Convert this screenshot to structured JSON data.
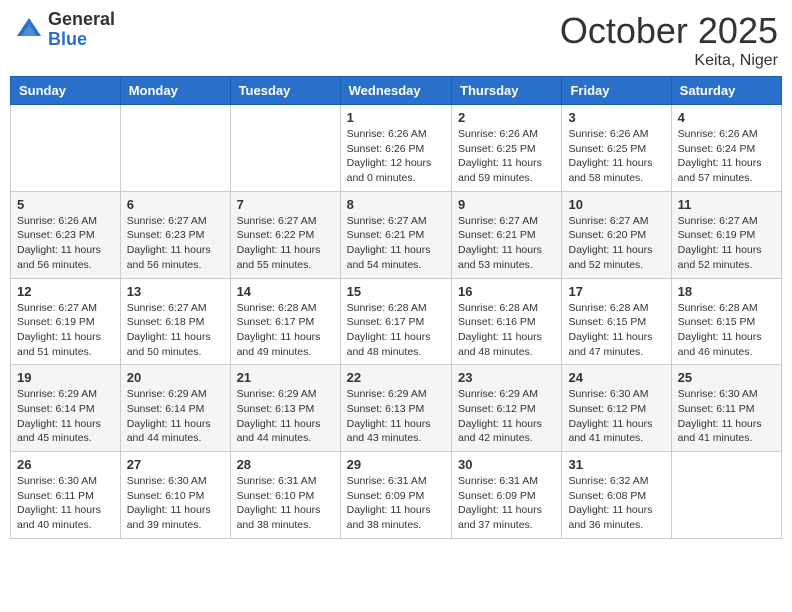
{
  "header": {
    "logo_general": "General",
    "logo_blue": "Blue",
    "month": "October 2025",
    "location": "Keita, Niger"
  },
  "weekdays": [
    "Sunday",
    "Monday",
    "Tuesday",
    "Wednesday",
    "Thursday",
    "Friday",
    "Saturday"
  ],
  "weeks": [
    [
      {
        "day": "",
        "sunrise": "",
        "sunset": "",
        "daylight": ""
      },
      {
        "day": "",
        "sunrise": "",
        "sunset": "",
        "daylight": ""
      },
      {
        "day": "",
        "sunrise": "",
        "sunset": "",
        "daylight": ""
      },
      {
        "day": "1",
        "sunrise": "Sunrise: 6:26 AM",
        "sunset": "Sunset: 6:26 PM",
        "daylight": "Daylight: 12 hours and 0 minutes."
      },
      {
        "day": "2",
        "sunrise": "Sunrise: 6:26 AM",
        "sunset": "Sunset: 6:25 PM",
        "daylight": "Daylight: 11 hours and 59 minutes."
      },
      {
        "day": "3",
        "sunrise": "Sunrise: 6:26 AM",
        "sunset": "Sunset: 6:25 PM",
        "daylight": "Daylight: 11 hours and 58 minutes."
      },
      {
        "day": "4",
        "sunrise": "Sunrise: 6:26 AM",
        "sunset": "Sunset: 6:24 PM",
        "daylight": "Daylight: 11 hours and 57 minutes."
      }
    ],
    [
      {
        "day": "5",
        "sunrise": "Sunrise: 6:26 AM",
        "sunset": "Sunset: 6:23 PM",
        "daylight": "Daylight: 11 hours and 56 minutes."
      },
      {
        "day": "6",
        "sunrise": "Sunrise: 6:27 AM",
        "sunset": "Sunset: 6:23 PM",
        "daylight": "Daylight: 11 hours and 56 minutes."
      },
      {
        "day": "7",
        "sunrise": "Sunrise: 6:27 AM",
        "sunset": "Sunset: 6:22 PM",
        "daylight": "Daylight: 11 hours and 55 minutes."
      },
      {
        "day": "8",
        "sunrise": "Sunrise: 6:27 AM",
        "sunset": "Sunset: 6:21 PM",
        "daylight": "Daylight: 11 hours and 54 minutes."
      },
      {
        "day": "9",
        "sunrise": "Sunrise: 6:27 AM",
        "sunset": "Sunset: 6:21 PM",
        "daylight": "Daylight: 11 hours and 53 minutes."
      },
      {
        "day": "10",
        "sunrise": "Sunrise: 6:27 AM",
        "sunset": "Sunset: 6:20 PM",
        "daylight": "Daylight: 11 hours and 52 minutes."
      },
      {
        "day": "11",
        "sunrise": "Sunrise: 6:27 AM",
        "sunset": "Sunset: 6:19 PM",
        "daylight": "Daylight: 11 hours and 52 minutes."
      }
    ],
    [
      {
        "day": "12",
        "sunrise": "Sunrise: 6:27 AM",
        "sunset": "Sunset: 6:19 PM",
        "daylight": "Daylight: 11 hours and 51 minutes."
      },
      {
        "day": "13",
        "sunrise": "Sunrise: 6:27 AM",
        "sunset": "Sunset: 6:18 PM",
        "daylight": "Daylight: 11 hours and 50 minutes."
      },
      {
        "day": "14",
        "sunrise": "Sunrise: 6:28 AM",
        "sunset": "Sunset: 6:17 PM",
        "daylight": "Daylight: 11 hours and 49 minutes."
      },
      {
        "day": "15",
        "sunrise": "Sunrise: 6:28 AM",
        "sunset": "Sunset: 6:17 PM",
        "daylight": "Daylight: 11 hours and 48 minutes."
      },
      {
        "day": "16",
        "sunrise": "Sunrise: 6:28 AM",
        "sunset": "Sunset: 6:16 PM",
        "daylight": "Daylight: 11 hours and 48 minutes."
      },
      {
        "day": "17",
        "sunrise": "Sunrise: 6:28 AM",
        "sunset": "Sunset: 6:15 PM",
        "daylight": "Daylight: 11 hours and 47 minutes."
      },
      {
        "day": "18",
        "sunrise": "Sunrise: 6:28 AM",
        "sunset": "Sunset: 6:15 PM",
        "daylight": "Daylight: 11 hours and 46 minutes."
      }
    ],
    [
      {
        "day": "19",
        "sunrise": "Sunrise: 6:29 AM",
        "sunset": "Sunset: 6:14 PM",
        "daylight": "Daylight: 11 hours and 45 minutes."
      },
      {
        "day": "20",
        "sunrise": "Sunrise: 6:29 AM",
        "sunset": "Sunset: 6:14 PM",
        "daylight": "Daylight: 11 hours and 44 minutes."
      },
      {
        "day": "21",
        "sunrise": "Sunrise: 6:29 AM",
        "sunset": "Sunset: 6:13 PM",
        "daylight": "Daylight: 11 hours and 44 minutes."
      },
      {
        "day": "22",
        "sunrise": "Sunrise: 6:29 AM",
        "sunset": "Sunset: 6:13 PM",
        "daylight": "Daylight: 11 hours and 43 minutes."
      },
      {
        "day": "23",
        "sunrise": "Sunrise: 6:29 AM",
        "sunset": "Sunset: 6:12 PM",
        "daylight": "Daylight: 11 hours and 42 minutes."
      },
      {
        "day": "24",
        "sunrise": "Sunrise: 6:30 AM",
        "sunset": "Sunset: 6:12 PM",
        "daylight": "Daylight: 11 hours and 41 minutes."
      },
      {
        "day": "25",
        "sunrise": "Sunrise: 6:30 AM",
        "sunset": "Sunset: 6:11 PM",
        "daylight": "Daylight: 11 hours and 41 minutes."
      }
    ],
    [
      {
        "day": "26",
        "sunrise": "Sunrise: 6:30 AM",
        "sunset": "Sunset: 6:11 PM",
        "daylight": "Daylight: 11 hours and 40 minutes."
      },
      {
        "day": "27",
        "sunrise": "Sunrise: 6:30 AM",
        "sunset": "Sunset: 6:10 PM",
        "daylight": "Daylight: 11 hours and 39 minutes."
      },
      {
        "day": "28",
        "sunrise": "Sunrise: 6:31 AM",
        "sunset": "Sunset: 6:10 PM",
        "daylight": "Daylight: 11 hours and 38 minutes."
      },
      {
        "day": "29",
        "sunrise": "Sunrise: 6:31 AM",
        "sunset": "Sunset: 6:09 PM",
        "daylight": "Daylight: 11 hours and 38 minutes."
      },
      {
        "day": "30",
        "sunrise": "Sunrise: 6:31 AM",
        "sunset": "Sunset: 6:09 PM",
        "daylight": "Daylight: 11 hours and 37 minutes."
      },
      {
        "day": "31",
        "sunrise": "Sunrise: 6:32 AM",
        "sunset": "Sunset: 6:08 PM",
        "daylight": "Daylight: 11 hours and 36 minutes."
      },
      {
        "day": "",
        "sunrise": "",
        "sunset": "",
        "daylight": ""
      }
    ]
  ]
}
